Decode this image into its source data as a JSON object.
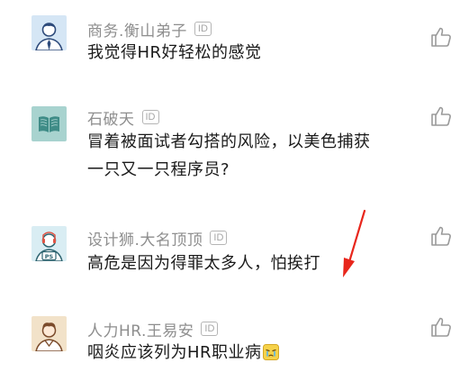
{
  "comments": [
    {
      "username": "商务.衡山弟子",
      "id_badge": "ID",
      "text": "我觉得HR好轻松的感觉",
      "avatar_icon": "businessman-avatar-icon"
    },
    {
      "username": "石破天",
      "id_badge": "ID",
      "text_line1": "冒着被面试者勾搭的风险，以美色捕获",
      "text_line2": "一只又一只程序员?",
      "avatar_icon": "book-avatar-icon"
    },
    {
      "username": "设计狮.大名顶顶",
      "id_badge": "ID",
      "text": "高危是因为得罪太多人，怕挨打",
      "avatar_icon": "designer-ps-avatar-icon"
    },
    {
      "username": "人力HR.王易安",
      "id_badge": "ID",
      "text": "咽炎应该列为HR职业病",
      "avatar_icon": "hr-person-avatar-icon",
      "trailing_emoji": "crying-face-emoji"
    }
  ],
  "colors": {
    "username": "#8e8e8e",
    "text": "#1a1a1a",
    "annotation_arrow": "#e8261c",
    "like_icon": "#9a9a9a"
  },
  "icons": {
    "like": "thumbs-up-icon",
    "annotation": "red-arrow-icon"
  }
}
